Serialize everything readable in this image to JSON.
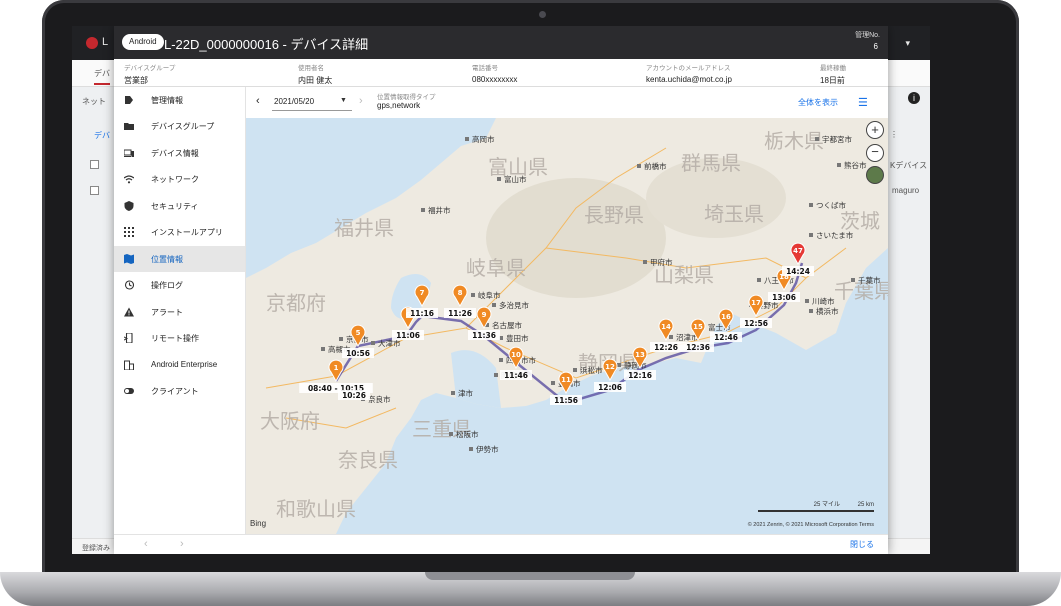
{
  "background_app": {
    "logo_text": "L",
    "nav_item": "デバ",
    "filter_label": "ネット",
    "list_link": "デバ",
    "row_right_text": "maguro",
    "right_header_text": "Kデバイス",
    "footer_text": "登録済み"
  },
  "modal": {
    "os_badge": "Android",
    "title": "L-22D_0000000016 - デバイス詳細",
    "management_label": "管理No.",
    "management_number": "6",
    "info": [
      {
        "label": "デバイスグループ",
        "value": "営業部"
      },
      {
        "label": "使用者名",
        "value": "内田 健太"
      },
      {
        "label": "電話番号",
        "value": "080xxxxxxxx"
      },
      {
        "label": "アカウントのメールアドレス",
        "value": "kenta.uchida@mot.co.jp"
      },
      {
        "label": "最終稼働",
        "value": "18日前"
      }
    ],
    "sidebar": [
      {
        "label": "管理情報",
        "icon": "tag-icon",
        "active": false
      },
      {
        "label": "デバイスグループ",
        "icon": "folder-icon",
        "active": false
      },
      {
        "label": "デバイス情報",
        "icon": "devices-icon",
        "active": false
      },
      {
        "label": "ネットワーク",
        "icon": "wifi-icon",
        "active": false
      },
      {
        "label": "セキュリティ",
        "icon": "shield-icon",
        "active": false
      },
      {
        "label": "インストールアプリ",
        "icon": "apps-grid-icon",
        "active": false
      },
      {
        "label": "位置情報",
        "icon": "map-icon",
        "active": true
      },
      {
        "label": "操作ログ",
        "icon": "history-icon",
        "active": false
      },
      {
        "label": "アラート",
        "icon": "warning-icon",
        "active": false
      },
      {
        "label": "リモート操作",
        "icon": "remote-phone-icon",
        "active": false
      },
      {
        "label": "Android Enterprise",
        "icon": "enterprise-building-icon",
        "active": false
      },
      {
        "label": "クライアント",
        "icon": "client-toggle-icon",
        "active": false
      }
    ],
    "toolbar": {
      "date": "2021/05/20",
      "type_label": "位置情報取得タイプ",
      "type_value": "gps,network",
      "show_all": "全体を表示"
    },
    "close_label": "閉じる"
  },
  "map": {
    "attribution_left": "Bing",
    "attribution_right": "© 2021 Zenrin, © 2021 Microsoft Corporation  Terms",
    "scale_miles": "25 マイル",
    "scale_km": "25 km",
    "prefectures": [
      {
        "name": "富山県"
      },
      {
        "name": "群馬県"
      },
      {
        "name": "栃木県"
      },
      {
        "name": "長野県"
      },
      {
        "name": "埼玉県"
      },
      {
        "name": "福井県"
      },
      {
        "name": "岐阜県"
      },
      {
        "name": "山梨県"
      },
      {
        "name": "京都府"
      },
      {
        "name": "静岡県"
      },
      {
        "name": "千葉県"
      },
      {
        "name": "大阪府"
      },
      {
        "name": "奈良県"
      },
      {
        "name": "三重県"
      },
      {
        "name": "和歌山県"
      },
      {
        "name": "茨城"
      }
    ],
    "cities": [
      {
        "name": "高岡市"
      },
      {
        "name": "前橋市"
      },
      {
        "name": "宇都宮市"
      },
      {
        "name": "富山市"
      },
      {
        "name": "さいたま市"
      },
      {
        "name": "つくば市"
      },
      {
        "name": "福井市"
      },
      {
        "name": "甲府市"
      },
      {
        "name": "八王子市"
      },
      {
        "name": "岐阜市"
      },
      {
        "name": "多治見市"
      },
      {
        "name": "名古屋市"
      },
      {
        "name": "豊田市"
      },
      {
        "name": "富士市"
      },
      {
        "name": "横浜市"
      },
      {
        "name": "川崎市"
      },
      {
        "name": "千葉市"
      },
      {
        "name": "津市"
      },
      {
        "name": "静岡市"
      },
      {
        "name": "浜松市"
      },
      {
        "name": "奈良市"
      },
      {
        "name": "京都市"
      },
      {
        "name": "高槻市"
      },
      {
        "name": "大津市"
      },
      {
        "name": "四日市市"
      },
      {
        "name": "豊橋市"
      },
      {
        "name": "松阪市"
      },
      {
        "name": "伊勢市"
      },
      {
        "name": "熊谷市"
      },
      {
        "name": "秦野市"
      },
      {
        "name": "沼津市"
      },
      {
        "name": "岡崎市"
      }
    ],
    "markers": [
      {
        "num": "1",
        "time": "08:40 - 10:15"
      },
      {
        "num": "5",
        "time": "10:56"
      },
      {
        "num": "",
        "time": "10:26"
      },
      {
        "num": "6",
        "time": "11:06"
      },
      {
        "num": "7",
        "time": "11:16"
      },
      {
        "num": "8",
        "time": "11:26"
      },
      {
        "num": "9",
        "time": "11:36"
      },
      {
        "num": "10",
        "time": "11:46"
      },
      {
        "num": "11",
        "time": "11:56"
      },
      {
        "num": "12",
        "time": "12:06"
      },
      {
        "num": "13",
        "time": "12:16"
      },
      {
        "num": "14",
        "time": "12:26"
      },
      {
        "num": "15",
        "time": "12:36"
      },
      {
        "num": "16",
        "time": "12:46"
      },
      {
        "num": "17",
        "time": "12:56"
      },
      {
        "num": "18",
        "time": "13:06"
      },
      {
        "num": "47",
        "time": "14:24"
      }
    ]
  }
}
